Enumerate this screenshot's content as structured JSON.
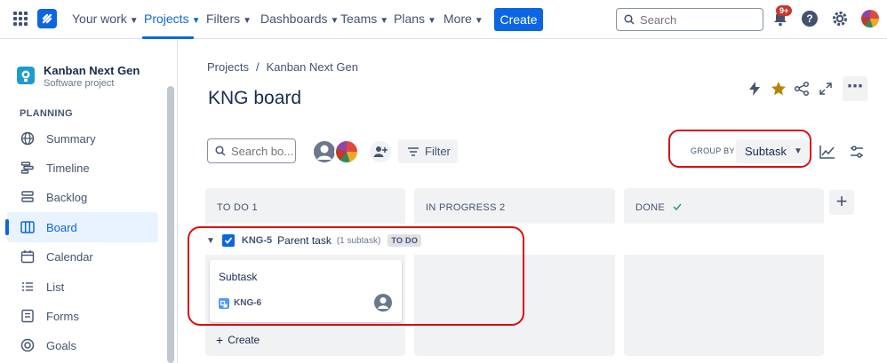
{
  "topnav": {
    "items": [
      {
        "label": "Your work",
        "name": "nav-your-work"
      },
      {
        "label": "Projects",
        "name": "nav-projects"
      },
      {
        "label": "Filters",
        "name": "nav-filters"
      },
      {
        "label": "Dashboards",
        "name": "nav-dashboards"
      },
      {
        "label": "Teams",
        "name": "nav-teams"
      },
      {
        "label": "Plans",
        "name": "nav-plans"
      },
      {
        "label": "More",
        "name": "nav-more"
      }
    ],
    "active": "Projects",
    "create_label": "Create",
    "search_placeholder": "Search",
    "notification_badge": "9+"
  },
  "sidebar": {
    "project_name": "Kanban Next Gen",
    "project_type": "Software project",
    "section": "PLANNING",
    "items": [
      {
        "label": "Summary",
        "icon": "globe-icon"
      },
      {
        "label": "Timeline",
        "icon": "timeline-icon"
      },
      {
        "label": "Backlog",
        "icon": "backlog-icon"
      },
      {
        "label": "Board",
        "icon": "board-icon"
      },
      {
        "label": "Calendar",
        "icon": "calendar-icon"
      },
      {
        "label": "List",
        "icon": "list-icon"
      },
      {
        "label": "Forms",
        "icon": "forms-icon"
      },
      {
        "label": "Goals",
        "icon": "goals-icon"
      }
    ],
    "active": "Board"
  },
  "main": {
    "breadcrumb": [
      "Projects",
      "Kanban Next Gen"
    ],
    "title": "KNG board",
    "board_search_placeholder": "Search bo...",
    "filter_label": "Filter",
    "group_by_label": "GROUP BY",
    "group_by_value": "Subtask",
    "columns": [
      {
        "title": "TO DO 1"
      },
      {
        "title": "IN PROGRESS 2"
      },
      {
        "title": "DONE"
      }
    ],
    "swimlane": {
      "key": "KNG-5",
      "title": "Parent task",
      "count": "(1 subtask)",
      "status": "TO DO"
    },
    "card": {
      "title": "Subtask",
      "key": "KNG-6"
    },
    "create_label": "Create"
  },
  "colors": {
    "accent": "#0c66e4",
    "highlight_outline": "#d90d0d",
    "star": "#b38600",
    "done_check": "#22a06b"
  }
}
